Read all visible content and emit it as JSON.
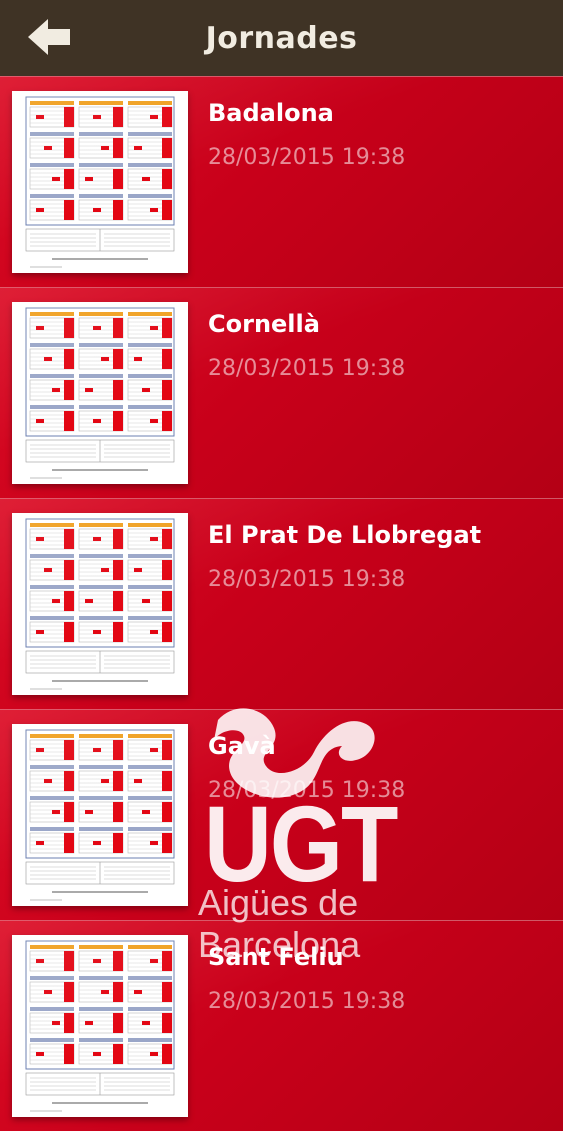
{
  "header": {
    "title": "Jornades",
    "back_icon": "back-arrow-icon"
  },
  "items": [
    {
      "name": "Badalona",
      "date": "28/03/2015 19:38"
    },
    {
      "name": "Cornellà",
      "date": "28/03/2015 19:38"
    },
    {
      "name": "El Prat De Llobregat",
      "date": "28/03/2015 19:38"
    },
    {
      "name": "Gavà",
      "date": "28/03/2015 19:38"
    },
    {
      "name": "Sant Feliu",
      "date": "28/03/2015 19:38"
    }
  ],
  "watermark": {
    "brand": "UGT",
    "line1": "Aigües de",
    "line2": "Barcelona"
  },
  "colors": {
    "header_bg": "#3f3325",
    "row_red": "#c8001a",
    "accent_red": "#e30613"
  }
}
